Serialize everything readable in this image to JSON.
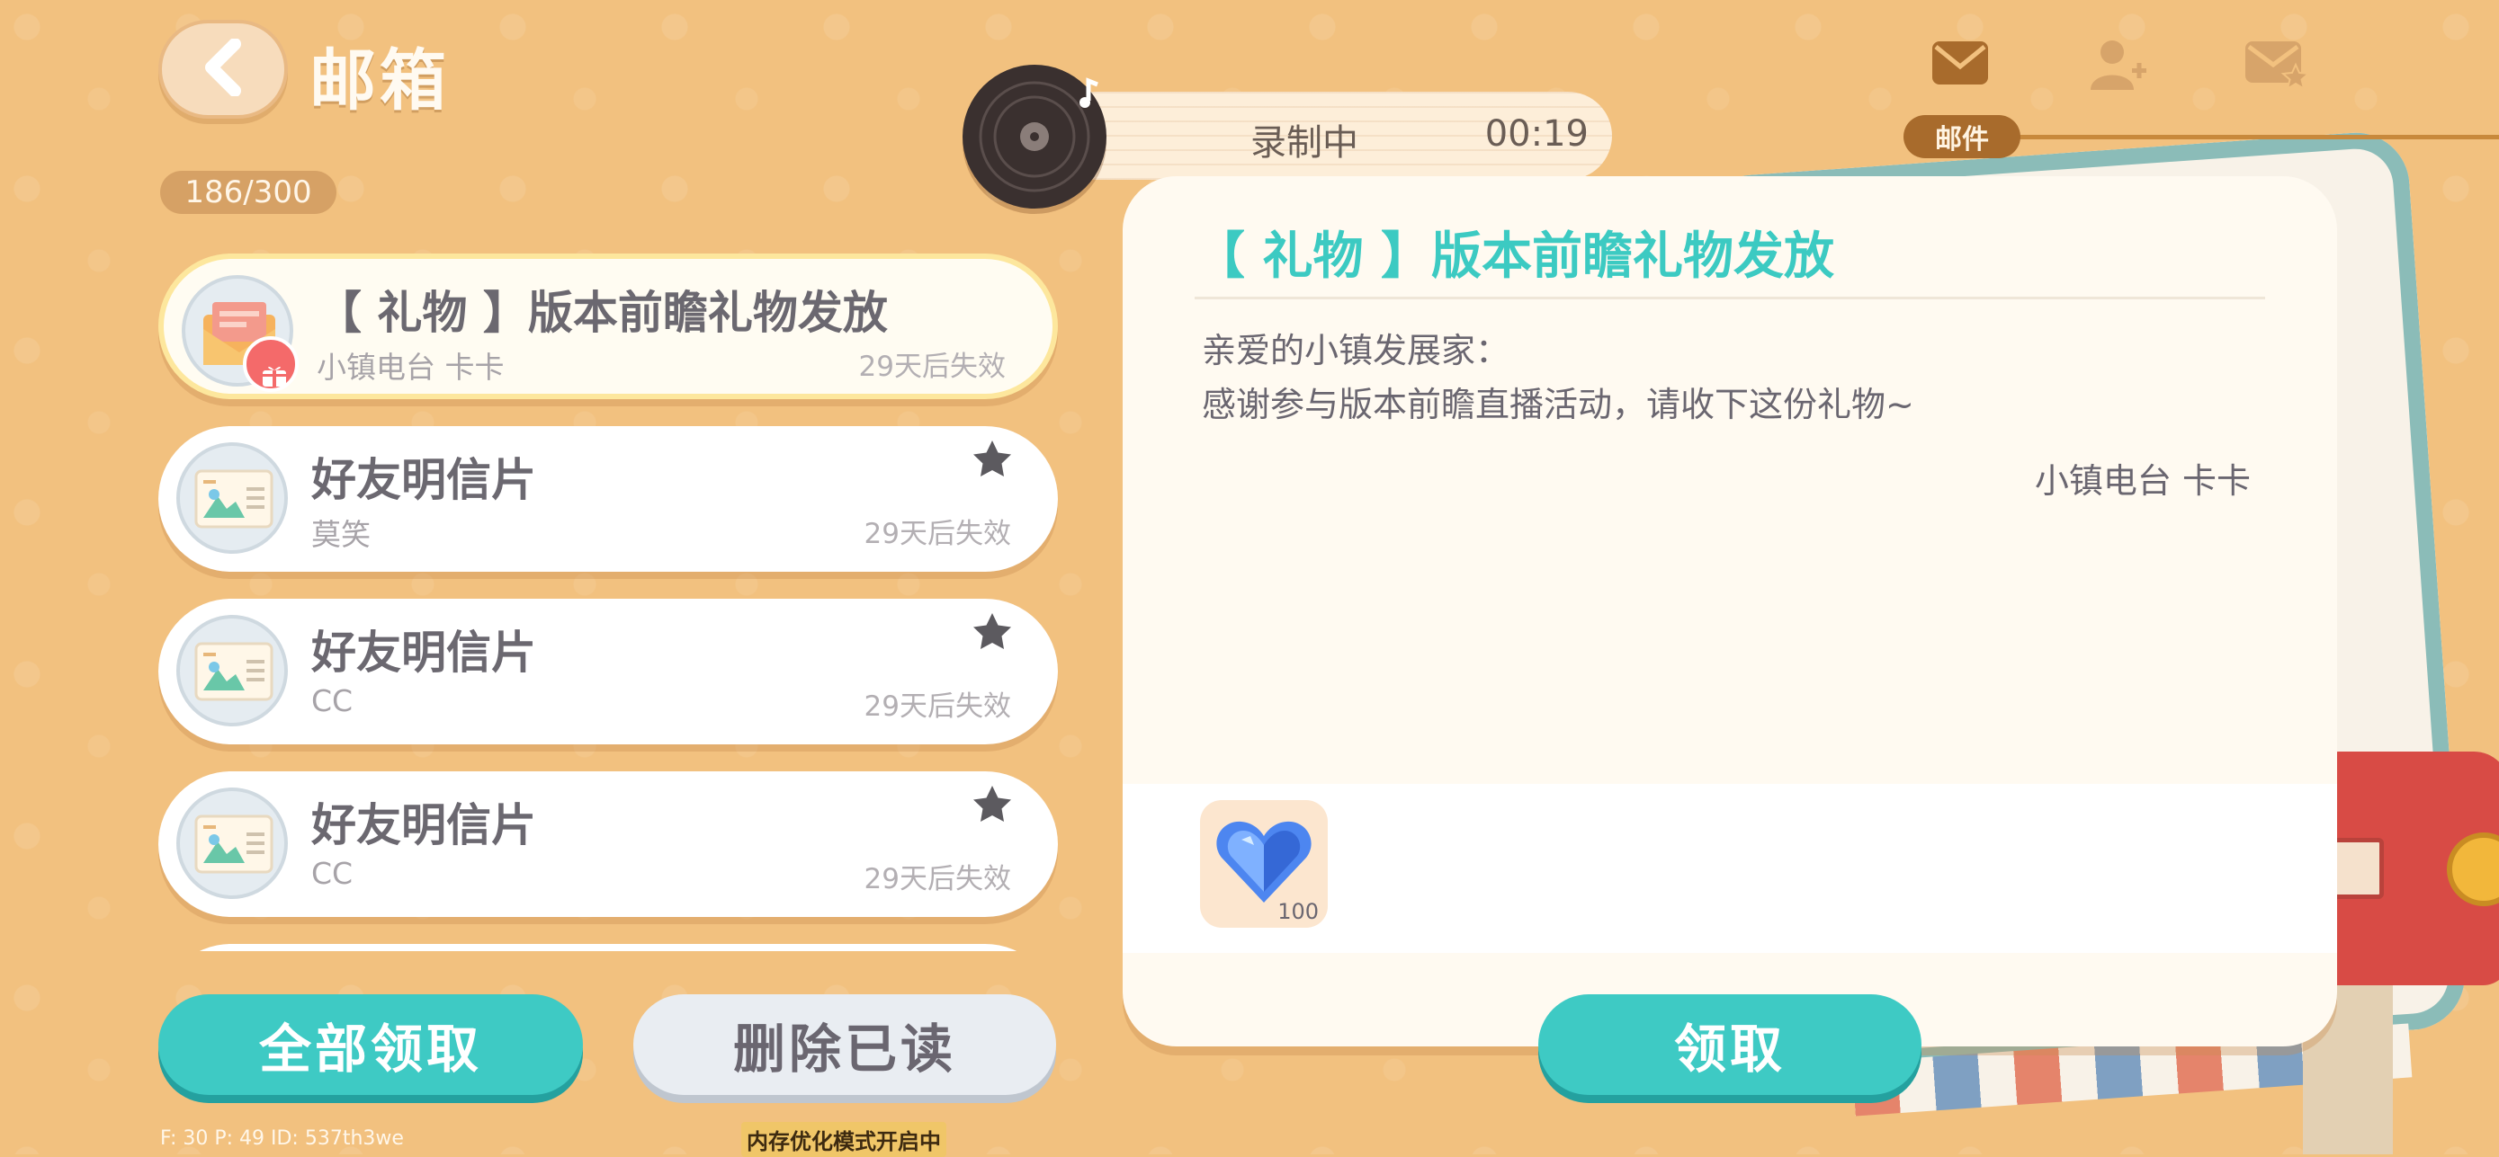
{
  "header": {
    "title": "邮箱",
    "counter": "186/300"
  },
  "recorder": {
    "label": "录制中",
    "time": "00:19"
  },
  "tabs": {
    "active_label": "邮件",
    "icons": [
      "mail-icon",
      "add-friend-icon",
      "starred-mail-icon"
    ]
  },
  "mail_list": [
    {
      "title": "【 礼物 】版本前瞻礼物发放",
      "sender": "小镇电台 卡卡",
      "expire": "29天后失效",
      "icon": "gift-mail-icon",
      "starred": false,
      "selected": true
    },
    {
      "title": "好友明信片",
      "sender": "莫笑",
      "expire": "29天后失效",
      "icon": "postcard-icon",
      "starred": true,
      "selected": false
    },
    {
      "title": "好友明信片",
      "sender": "CC",
      "expire": "29天后失效",
      "icon": "postcard-icon",
      "starred": true,
      "selected": false
    },
    {
      "title": "好友明信片",
      "sender": "CC",
      "expire": "29天后失效",
      "icon": "postcard-icon",
      "starred": true,
      "selected": false
    }
  ],
  "buttons": {
    "claim_all": "全部领取",
    "delete_read": "删除已读",
    "claim": "领取"
  },
  "detail": {
    "title": "【 礼物 】版本前瞻礼物发放",
    "greeting": "亲爱的小镇发展家：",
    "body": "感谢参与版本前瞻直播活动，请收下这份礼物~",
    "signature": "小镇电台 卡卡",
    "attachments": [
      {
        "icon": "blue-heart-gem-icon",
        "count": "100"
      }
    ]
  },
  "debug": {
    "stats": "F: 30    P: 49    ID: 537th3we",
    "memory_mode": "内存优化模式开启中"
  },
  "colors": {
    "background": "#f2c17f",
    "accent": "#3ecac4",
    "panel": "#fffaf1"
  }
}
